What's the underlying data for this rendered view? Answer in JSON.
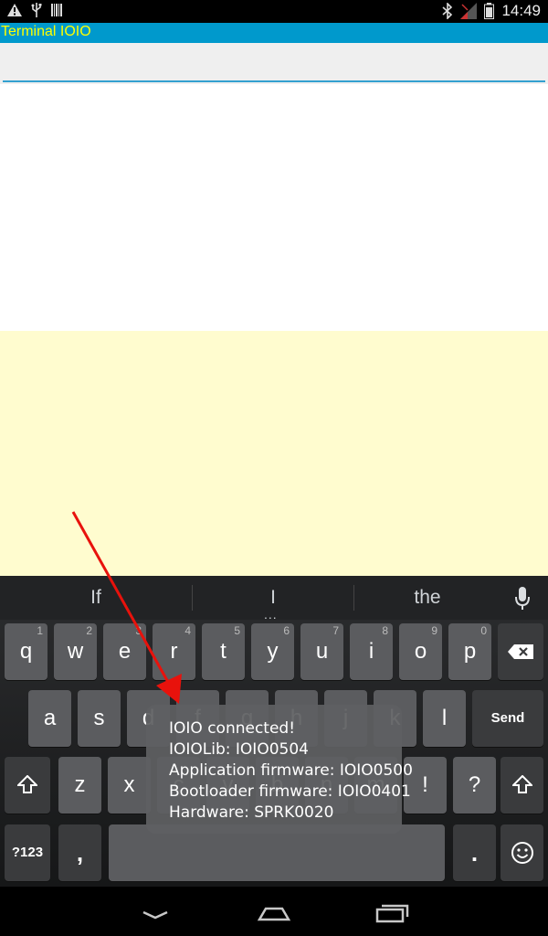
{
  "status_bar": {
    "time": "14:49",
    "left_icons": [
      "warning-icon",
      "usb-icon",
      "barcode-icon"
    ],
    "right_icons": [
      "bluetooth-icon",
      "signal-icon",
      "battery-icon"
    ]
  },
  "app": {
    "title": "Terminal IOIO",
    "title_color": "#ffff00",
    "titlebar_color": "#0099cc",
    "input_value": "",
    "terminal_bg": "#fffccf"
  },
  "keyboard": {
    "suggestions": [
      "If",
      "I",
      "the"
    ],
    "row1": [
      {
        "label": "q",
        "hint": "1"
      },
      {
        "label": "w",
        "hint": "2"
      },
      {
        "label": "e",
        "hint": "3"
      },
      {
        "label": "r",
        "hint": "4"
      },
      {
        "label": "t",
        "hint": "5"
      },
      {
        "label": "y",
        "hint": "6"
      },
      {
        "label": "u",
        "hint": "7"
      },
      {
        "label": "i",
        "hint": "8"
      },
      {
        "label": "o",
        "hint": "9"
      },
      {
        "label": "p",
        "hint": "0"
      }
    ],
    "row2": [
      "a",
      "s",
      "d",
      "f",
      "g",
      "h",
      "j",
      "k",
      "l"
    ],
    "send_label": "Send",
    "row3": [
      "z",
      "x",
      "c",
      "v",
      "b",
      "n",
      "m",
      "!",
      "?"
    ],
    "row4": {
      "symbols_label": "?123",
      "comma_label": ",",
      "period_label": ".",
      "emoji_icon": "smiley-icon"
    }
  },
  "toast": {
    "lines": [
      "IOIO connected!",
      "IOIOLib: IOIO0504",
      "Application firmware: IOIO0500",
      "Bootloader firmware: IOIO0401",
      "Hardware: SPRK0020"
    ]
  },
  "annotation": {
    "arrow_color": "#e8120c"
  },
  "nav_bar": {
    "buttons": [
      "back-icon",
      "home-icon",
      "recents-icon"
    ]
  }
}
